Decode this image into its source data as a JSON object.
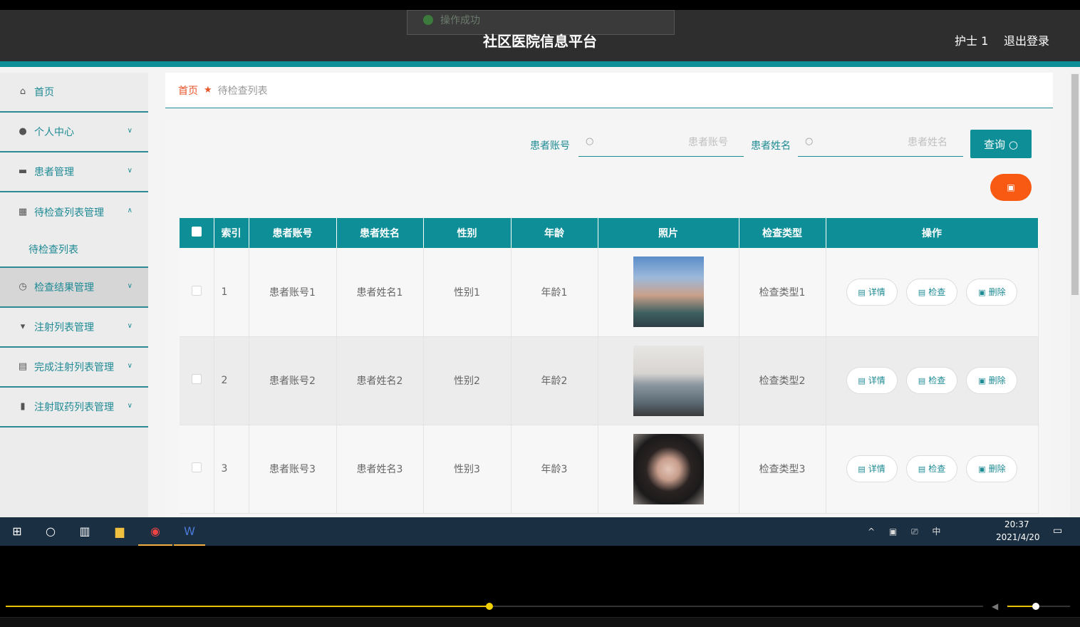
{
  "header": {
    "toast": "操作成功",
    "title": "社区医院信息平台",
    "user": "护士 1",
    "logout": "退出登录"
  },
  "sidebar": {
    "items": [
      {
        "label": "首页",
        "icon": "home-icon"
      },
      {
        "label": "个人中心",
        "icon": "user-icon"
      },
      {
        "label": "患者管理",
        "icon": "briefcase-icon"
      },
      {
        "label": "待检查列表管理",
        "icon": "grid-icon"
      },
      {
        "label": "检查结果管理",
        "icon": "clock-icon"
      },
      {
        "label": "注射列表管理",
        "icon": "pin-icon"
      },
      {
        "label": "完成注射列表管理",
        "icon": "clipboard-icon"
      },
      {
        "label": "注射取药列表管理",
        "icon": "bar-chart-icon"
      }
    ],
    "submenu": "待检查列表"
  },
  "breadcrumb": {
    "home": "首页",
    "current": "待检查列表"
  },
  "search": {
    "account_label": "患者账号",
    "account_placeholder": "患者账号",
    "name_label": "患者姓名",
    "name_placeholder": "患者姓名",
    "query_button": "查询"
  },
  "table": {
    "headers": [
      "索引",
      "患者账号",
      "患者姓名",
      "性别",
      "年龄",
      "照片",
      "检查类型",
      "操作"
    ],
    "rows": [
      {
        "index": "1",
        "account": "患者账号1",
        "name": "患者姓名1",
        "gender": "性别1",
        "age": "年龄1",
        "type": "检查类型1"
      },
      {
        "index": "2",
        "account": "患者账号2",
        "name": "患者姓名2",
        "gender": "性别2",
        "age": "年龄2",
        "type": "检查类型2"
      },
      {
        "index": "3",
        "account": "患者账号3",
        "name": "患者姓名3",
        "gender": "性别3",
        "age": "年龄3",
        "type": "检查类型3"
      }
    ],
    "actions": {
      "detail": "详情",
      "check": "检查",
      "delete": "删除"
    }
  },
  "taskbar": {
    "time": "20:37",
    "date": "2021/4/20",
    "tray": "^ ▣ ⎚ 中"
  },
  "player": {
    "progress": 0.495,
    "volume": 0.45
  },
  "colors": {
    "accent": "#0e8f98",
    "danger": "#f95a13",
    "header_bg": "#2e2e2e"
  }
}
